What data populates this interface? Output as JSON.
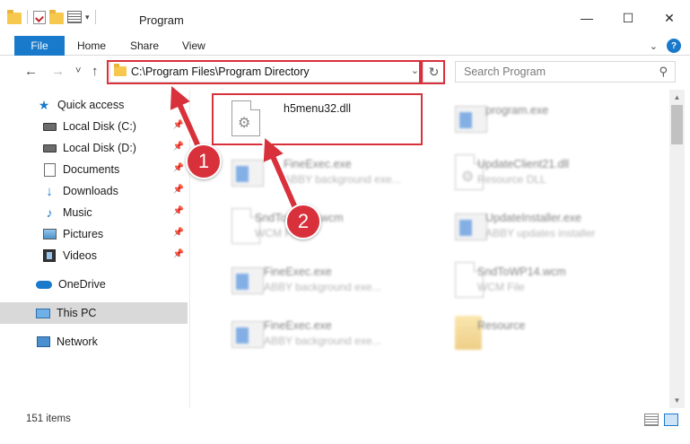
{
  "window": {
    "title": "Program",
    "minimize_glyph": "—",
    "maximize_glyph": "☐",
    "close_glyph": "✕"
  },
  "ribbon": {
    "tabs": [
      "File",
      "Home",
      "Share",
      "View"
    ],
    "expand_glyph": "⌄",
    "help_glyph": "?"
  },
  "navigation": {
    "back_glyph": "←",
    "forward_glyph": "→",
    "recent_glyph": "˅",
    "up_glyph": "↑",
    "address": "C:\\Program Files\\Program Directory",
    "refresh_glyph": "↻",
    "search_placeholder": "Search Program",
    "search_glyph": "⚲"
  },
  "sidebar": {
    "items": [
      {
        "label": "Quick access",
        "icon": "star-icon"
      },
      {
        "label": "Local Disk (C:)",
        "icon": "disk-icon",
        "pinned": true
      },
      {
        "label": "Local Disk (D:)",
        "icon": "disk-icon",
        "pinned": true
      },
      {
        "label": "Documents",
        "icon": "documents-icon",
        "pinned": true
      },
      {
        "label": "Downloads",
        "icon": "download-icon",
        "pinned": true
      },
      {
        "label": "Music",
        "icon": "music-icon",
        "pinned": true
      },
      {
        "label": "Pictures",
        "icon": "pictures-icon",
        "pinned": true
      },
      {
        "label": "Videos",
        "icon": "videos-icon",
        "pinned": true
      },
      {
        "label": "OneDrive",
        "icon": "cloud-icon"
      },
      {
        "label": "This PC",
        "icon": "pc-icon",
        "selected": true
      },
      {
        "label": "Network",
        "icon": "network-icon"
      }
    ],
    "pin_glyph": "📌"
  },
  "files": [
    {
      "name": "h5menu32.dll",
      "desc": "",
      "icon": "gear-document-icon",
      "highlighted": true
    },
    {
      "name": "program.exe",
      "desc": "",
      "icon": "exe-icon"
    },
    {
      "name": "FineExec.exe",
      "desc": "ABBY background exe...",
      "icon": "exe-icon"
    },
    {
      "name": "UpdateClient21.dll",
      "desc": "Resource DLL",
      "icon": "gear-document-icon"
    },
    {
      "name": "SndToWP14.wcm",
      "desc": "WCM File",
      "icon": "document-icon"
    },
    {
      "name": "UpdateInstaller.exe",
      "desc": "ABBY updates installer",
      "icon": "exe-icon"
    },
    {
      "name": "FineExec.exe",
      "desc": "ABBY background exe...",
      "icon": "exe-icon"
    },
    {
      "name": "SndToWP14.wcm",
      "desc": "WCM File",
      "icon": "document-icon"
    },
    {
      "name": "FineExec.exe",
      "desc": "ABBY background exe...",
      "icon": "exe-icon"
    },
    {
      "name": "Resource",
      "desc": "",
      "icon": "folder-icon"
    }
  ],
  "status": {
    "item_count": "151 items"
  },
  "annotations": {
    "step1": "1",
    "step2": "2",
    "color": "#d8313b"
  },
  "colors": {
    "accent": "#1979ca",
    "annotation": "#d8313b"
  }
}
